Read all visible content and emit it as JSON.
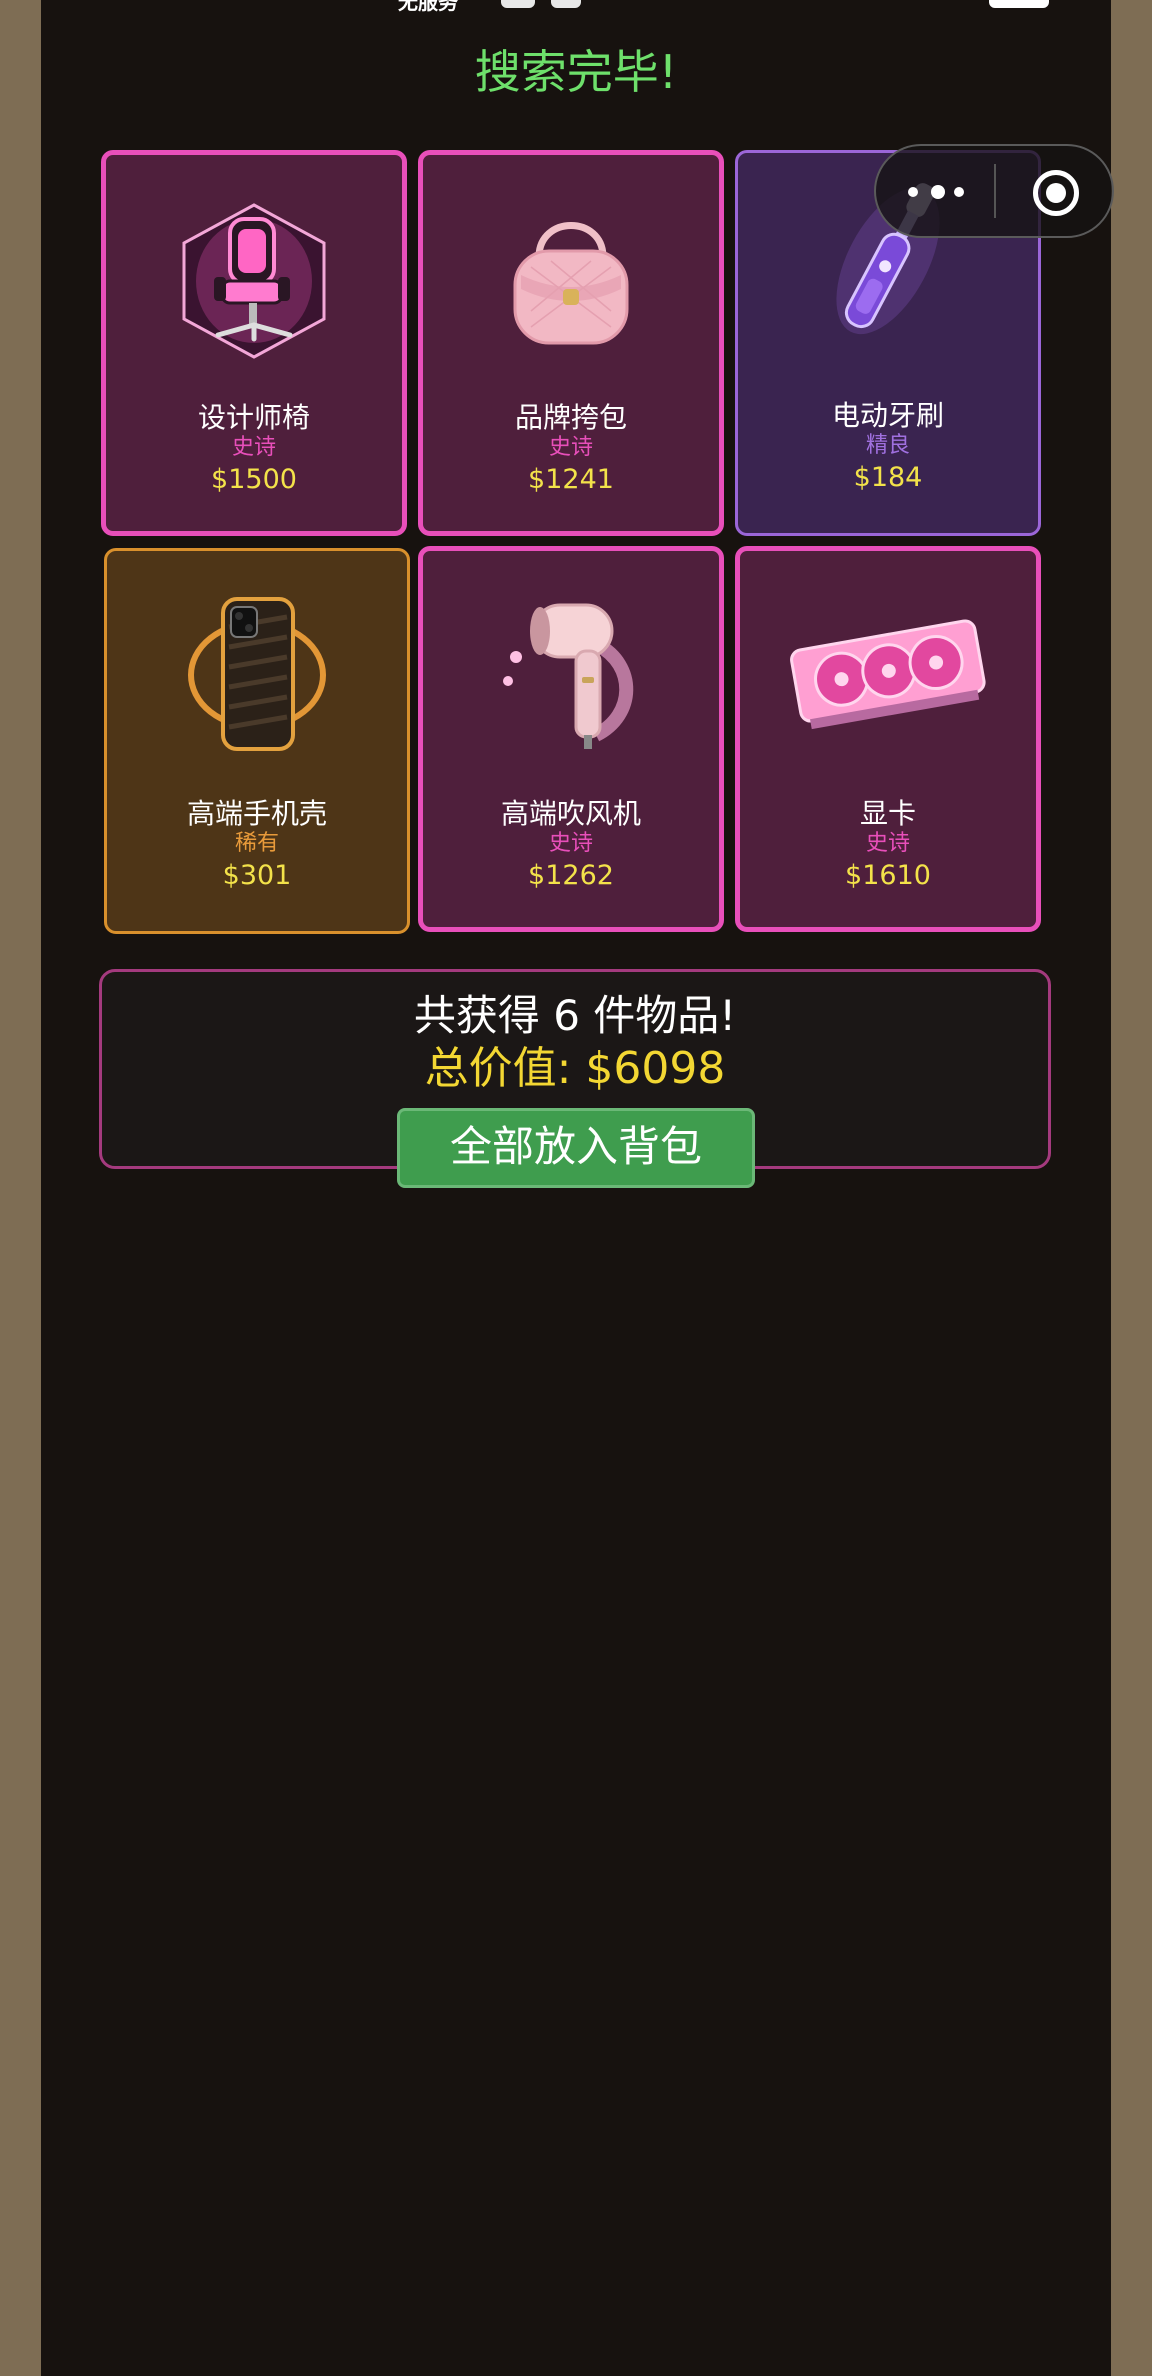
{
  "status_bar": {
    "carrier": "无服务"
  },
  "title": "搜索完毕!",
  "items": [
    {
      "name": "设计师椅",
      "rarity": "史诗",
      "price": "$1500",
      "icon": "gaming-chair-icon",
      "rarity_color": "#e84fba"
    },
    {
      "name": "品牌挎包",
      "rarity": "史诗",
      "price": "$1241",
      "icon": "handbag-icon",
      "rarity_color": "#e84fba"
    },
    {
      "name": "电动牙刷",
      "rarity": "精良",
      "price": "$184",
      "icon": "electric-toothbrush-icon",
      "rarity_color": "#a070e0"
    },
    {
      "name": "高端手机壳",
      "rarity": "稀有",
      "price": "$301",
      "icon": "phone-case-icon",
      "rarity_color": "#e89a3a"
    },
    {
      "name": "高端吹风机",
      "rarity": "史诗",
      "price": "$1262",
      "icon": "hair-dryer-icon",
      "rarity_color": "#e84fba"
    },
    {
      "name": "显卡",
      "rarity": "史诗",
      "price": "$1610",
      "icon": "graphics-card-icon",
      "rarity_color": "#e84fba"
    }
  ],
  "summary": {
    "count_text": "共获得 6 件物品!",
    "total_text": "总价值: $6098"
  },
  "actions": {
    "pack_all_label": "全部放入背包"
  },
  "capsule": {
    "more_icon": "more-dots-icon",
    "close_icon": "close-circle-icon"
  },
  "colors": {
    "title": "#6ee06b",
    "price": "#f3e24a",
    "total": "#f3d733",
    "button": "#3f9d4e"
  }
}
